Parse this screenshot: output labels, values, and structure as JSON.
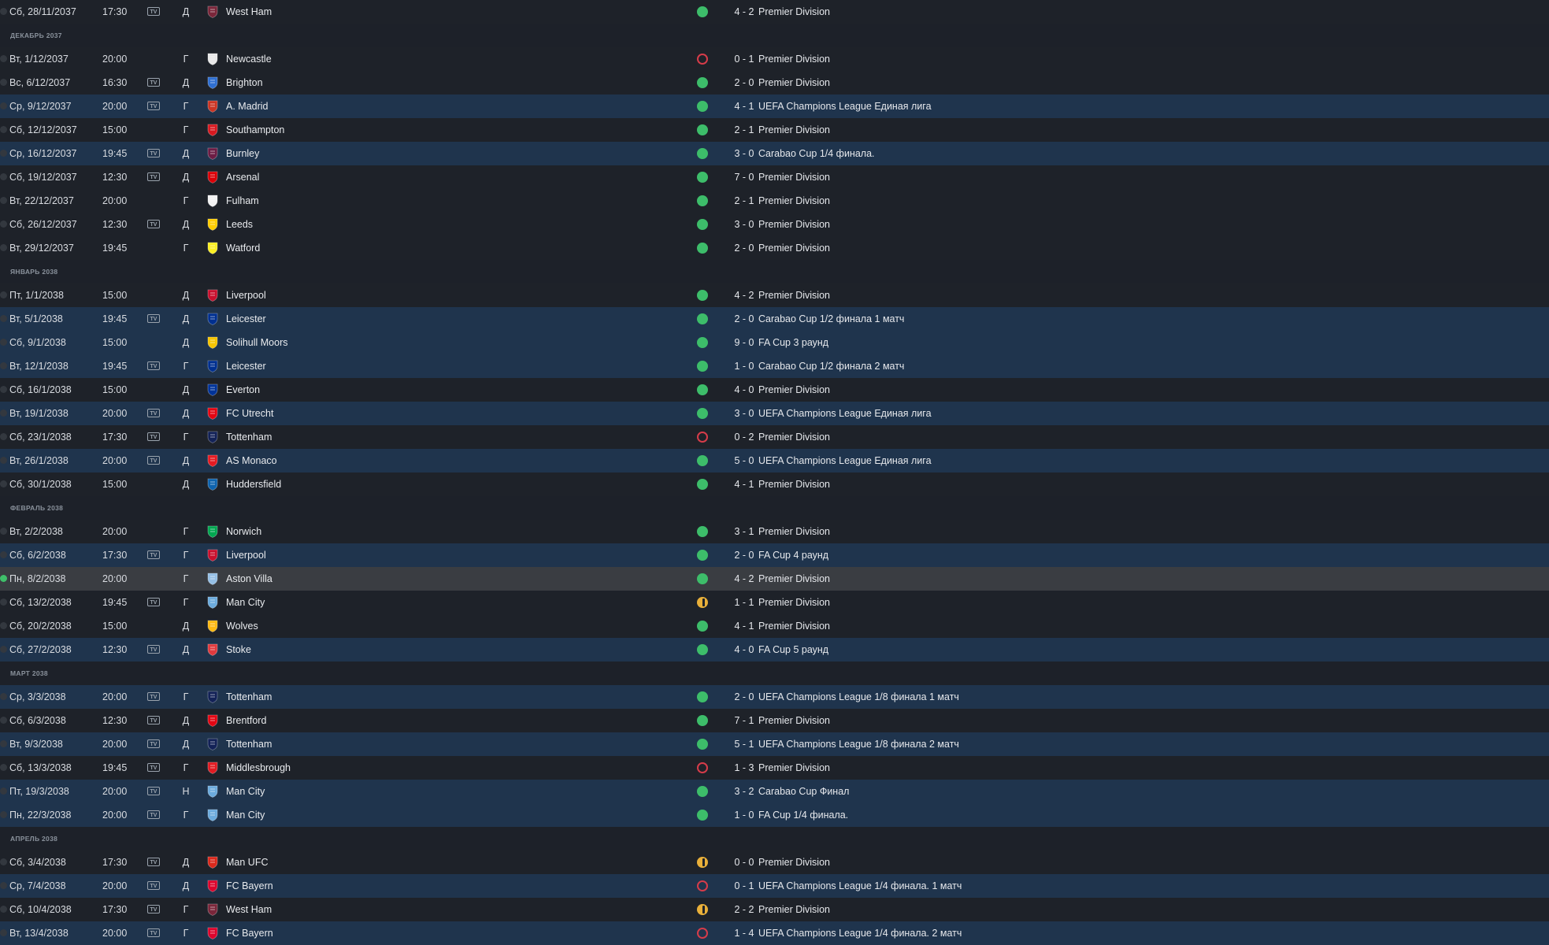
{
  "rows": [
    {
      "kind": "match",
      "date": "Сб, 28/11/2037",
      "time": "17:30",
      "tv": true,
      "venue": "Д",
      "team": "West Ham",
      "crest": "#7a263a",
      "result": "W",
      "score": "4 - 2",
      "competition": "Premier Division",
      "style": "dark"
    },
    {
      "kind": "month",
      "label": "ДЕКАБРЬ 2037"
    },
    {
      "kind": "match",
      "date": "Вт, 1/12/2037",
      "time": "20:00",
      "tv": false,
      "venue": "Г",
      "team": "Newcastle",
      "crest": "#e8e8e8",
      "result": "L",
      "score": "0 - 1",
      "competition": "Premier Division",
      "style": "dark"
    },
    {
      "kind": "match",
      "date": "Вс, 6/12/2037",
      "time": "16:30",
      "tv": true,
      "venue": "Д",
      "team": "Brighton",
      "crest": "#2f6fd1",
      "result": "W",
      "score": "2 - 0",
      "competition": "Premier Division",
      "style": "dark"
    },
    {
      "kind": "match",
      "date": "Ср, 9/12/2037",
      "time": "20:00",
      "tv": true,
      "venue": "Г",
      "team": "A. Madrid",
      "crest": "#cb3524",
      "result": "W",
      "score": "4 - 1",
      "competition": "UEFA Champions League Единая лига",
      "style": "blue"
    },
    {
      "kind": "match",
      "date": "Сб, 12/12/2037",
      "time": "15:00",
      "tv": false,
      "venue": "Г",
      "team": "Southampton",
      "crest": "#d71920",
      "result": "W",
      "score": "2 - 1",
      "competition": "Premier Division",
      "style": "dark"
    },
    {
      "kind": "match",
      "date": "Ср, 16/12/2037",
      "time": "19:45",
      "tv": true,
      "venue": "Д",
      "team": "Burnley",
      "crest": "#6c1d45",
      "result": "W",
      "score": "3 - 0",
      "competition": "Carabao Cup 1/4 финала.",
      "style": "blue"
    },
    {
      "kind": "match",
      "date": "Сб, 19/12/2037",
      "time": "12:30",
      "tv": true,
      "venue": "Д",
      "team": "Arsenal",
      "crest": "#db0007",
      "result": "W",
      "score": "7 - 0",
      "competition": "Premier Division",
      "style": "dark"
    },
    {
      "kind": "match",
      "date": "Вт, 22/12/2037",
      "time": "20:00",
      "tv": false,
      "venue": "Г",
      "team": "Fulham",
      "crest": "#f2f2f2",
      "result": "W",
      "score": "2 - 1",
      "competition": "Premier Division",
      "style": "dark"
    },
    {
      "kind": "match",
      "date": "Сб, 26/12/2037",
      "time": "12:30",
      "tv": true,
      "venue": "Д",
      "team": "Leeds",
      "crest": "#ffcd00",
      "result": "W",
      "score": "3 - 0",
      "competition": "Premier Division",
      "style": "dark"
    },
    {
      "kind": "match",
      "date": "Вт, 29/12/2037",
      "time": "19:45",
      "tv": false,
      "venue": "Г",
      "team": "Watford",
      "crest": "#fbee23",
      "result": "W",
      "score": "2 - 0",
      "competition": "Premier Division",
      "style": "dark"
    },
    {
      "kind": "month",
      "label": "ЯНВАРЬ 2038"
    },
    {
      "kind": "match",
      "date": "Пт, 1/1/2038",
      "time": "15:00",
      "tv": false,
      "venue": "Д",
      "team": "Liverpool",
      "crest": "#c8102e",
      "result": "W",
      "score": "4 - 2",
      "competition": "Premier Division",
      "style": "dark"
    },
    {
      "kind": "match",
      "date": "Вт, 5/1/2038",
      "time": "19:45",
      "tv": true,
      "venue": "Д",
      "team": "Leicester",
      "crest": "#003090",
      "result": "W",
      "score": "2 - 0",
      "competition": "Carabao Cup 1/2 финала 1 матч",
      "style": "blue"
    },
    {
      "kind": "match",
      "date": "Сб, 9/1/2038",
      "time": "15:00",
      "tv": false,
      "venue": "Д",
      "team": "Solihull Moors",
      "crest": "#f6c400",
      "result": "W",
      "score": "9 - 0",
      "competition": "FA Cup 3 раунд",
      "style": "blue"
    },
    {
      "kind": "match",
      "date": "Вт, 12/1/2038",
      "time": "19:45",
      "tv": true,
      "venue": "Г",
      "team": "Leicester",
      "crest": "#003090",
      "result": "W",
      "score": "1 - 0",
      "competition": "Carabao Cup 1/2 финала 2 матч",
      "style": "blue"
    },
    {
      "kind": "match",
      "date": "Сб, 16/1/2038",
      "time": "15:00",
      "tv": false,
      "venue": "Д",
      "team": "Everton",
      "crest": "#003399",
      "result": "W",
      "score": "4 - 0",
      "competition": "Premier Division",
      "style": "dark"
    },
    {
      "kind": "match",
      "date": "Вт, 19/1/2038",
      "time": "20:00",
      "tv": true,
      "venue": "Д",
      "team": "FC Utrecht",
      "crest": "#e30613",
      "result": "W",
      "score": "3 - 0",
      "competition": "UEFA Champions League Единая лига",
      "style": "blue"
    },
    {
      "kind": "match",
      "date": "Сб, 23/1/2038",
      "time": "17:30",
      "tv": true,
      "venue": "Г",
      "team": "Tottenham",
      "crest": "#132257",
      "result": "L",
      "score": "0 - 2",
      "competition": "Premier Division",
      "style": "dark"
    },
    {
      "kind": "match",
      "date": "Вт, 26/1/2038",
      "time": "20:00",
      "tv": true,
      "venue": "Д",
      "team": "AS Monaco",
      "crest": "#e51b22",
      "result": "W",
      "score": "5 - 0",
      "competition": "UEFA Champions League Единая лига",
      "style": "blue"
    },
    {
      "kind": "match",
      "date": "Сб, 30/1/2038",
      "time": "15:00",
      "tv": false,
      "venue": "Д",
      "team": "Huddersfield",
      "crest": "#0e63ad",
      "result": "W",
      "score": "4 - 1",
      "competition": "Premier Division",
      "style": "dark"
    },
    {
      "kind": "month",
      "label": "ФЕВРАЛЬ 2038"
    },
    {
      "kind": "match",
      "date": "Вт, 2/2/2038",
      "time": "20:00",
      "tv": false,
      "venue": "Г",
      "team": "Norwich",
      "crest": "#00a650",
      "result": "W",
      "score": "3 - 1",
      "competition": "Premier Division",
      "style": "dark"
    },
    {
      "kind": "match",
      "date": "Сб, 6/2/2038",
      "time": "17:30",
      "tv": true,
      "venue": "Г",
      "team": "Liverpool",
      "crest": "#c8102e",
      "result": "W",
      "score": "2 - 0",
      "competition": "FA Cup 4 раунд",
      "style": "blue"
    },
    {
      "kind": "match",
      "date": "Пн, 8/2/2038",
      "time": "20:00",
      "tv": false,
      "venue": "Г",
      "team": "Aston Villa",
      "crest": "#95bfe5",
      "result": "W",
      "score": "4 - 2",
      "competition": "Premier Division",
      "style": "sel",
      "checked": true
    },
    {
      "kind": "match",
      "date": "Сб, 13/2/2038",
      "time": "19:45",
      "tv": true,
      "venue": "Г",
      "team": "Man City",
      "crest": "#6cabdd",
      "result": "D",
      "score": "1 - 1",
      "competition": "Premier Division",
      "style": "dark"
    },
    {
      "kind": "match",
      "date": "Сб, 20/2/2038",
      "time": "15:00",
      "tv": false,
      "venue": "Д",
      "team": "Wolves",
      "crest": "#fdb913",
      "result": "W",
      "score": "4 - 1",
      "competition": "Premier Division",
      "style": "dark"
    },
    {
      "kind": "match",
      "date": "Сб, 27/2/2038",
      "time": "12:30",
      "tv": true,
      "venue": "Д",
      "team": "Stoke",
      "crest": "#e03a3e",
      "result": "W",
      "score": "4 - 0",
      "competition": "FA Cup 5 раунд",
      "style": "blue"
    },
    {
      "kind": "month",
      "label": "МАРТ 2038"
    },
    {
      "kind": "match",
      "date": "Ср, 3/3/2038",
      "time": "20:00",
      "tv": true,
      "venue": "Г",
      "team": "Tottenham",
      "crest": "#132257",
      "result": "W",
      "score": "2 - 0",
      "competition": "UEFA Champions League 1/8 финала 1 матч",
      "style": "blue"
    },
    {
      "kind": "match",
      "date": "Сб, 6/3/2038",
      "time": "12:30",
      "tv": true,
      "venue": "Д",
      "team": "Brentford",
      "crest": "#e30613",
      "result": "W",
      "score": "7 - 1",
      "competition": "Premier Division",
      "style": "dark"
    },
    {
      "kind": "match",
      "date": "Вт, 9/3/2038",
      "time": "20:00",
      "tv": true,
      "venue": "Д",
      "team": "Tottenham",
      "crest": "#132257",
      "result": "W",
      "score": "5 - 1",
      "competition": "UEFA Champions League 1/8 финала 2 матч",
      "style": "blue"
    },
    {
      "kind": "match",
      "date": "Сб, 13/3/2038",
      "time": "19:45",
      "tv": true,
      "venue": "Г",
      "team": "Middlesbrough",
      "crest": "#e11b22",
      "result": "L",
      "score": "1 - 3",
      "competition": "Premier Division",
      "style": "dark"
    },
    {
      "kind": "match",
      "date": "Пт, 19/3/2038",
      "time": "20:00",
      "tv": true,
      "venue": "Н",
      "team": "Man City",
      "crest": "#6cabdd",
      "result": "W",
      "score": "3 - 2",
      "competition": "Carabao Cup Финал",
      "style": "blue"
    },
    {
      "kind": "match",
      "date": "Пн, 22/3/2038",
      "time": "20:00",
      "tv": true,
      "venue": "Г",
      "team": "Man City",
      "crest": "#6cabdd",
      "result": "W",
      "score": "1 - 0",
      "competition": "FA Cup 1/4 финала.",
      "style": "blue"
    },
    {
      "kind": "month",
      "label": "АПРЕЛЬ 2038"
    },
    {
      "kind": "match",
      "date": "Сб, 3/4/2038",
      "time": "17:30",
      "tv": true,
      "venue": "Д",
      "team": "Man UFC",
      "crest": "#da291c",
      "result": "D",
      "score": "0 - 0",
      "competition": "Premier Division",
      "style": "dark"
    },
    {
      "kind": "match",
      "date": "Ср, 7/4/2038",
      "time": "20:00",
      "tv": true,
      "venue": "Д",
      "team": "FC Bayern",
      "crest": "#dc052d",
      "result": "L",
      "score": "0 - 1",
      "competition": "UEFA Champions League 1/4 финала. 1 матч",
      "style": "blue"
    },
    {
      "kind": "match",
      "date": "Сб, 10/4/2038",
      "time": "17:30",
      "tv": true,
      "venue": "Г",
      "team": "West Ham",
      "crest": "#7a263a",
      "result": "D",
      "score": "2 - 2",
      "competition": "Premier Division",
      "style": "dark"
    },
    {
      "kind": "match",
      "date": "Вт, 13/4/2038",
      "time": "20:00",
      "tv": true,
      "venue": "Г",
      "team": "FC Bayern",
      "crest": "#dc052d",
      "result": "L",
      "score": "1 - 4",
      "competition": "UEFA Champions League 1/4 финала. 2 матч",
      "style": "blue"
    }
  ],
  "tv_glyph": "TV"
}
